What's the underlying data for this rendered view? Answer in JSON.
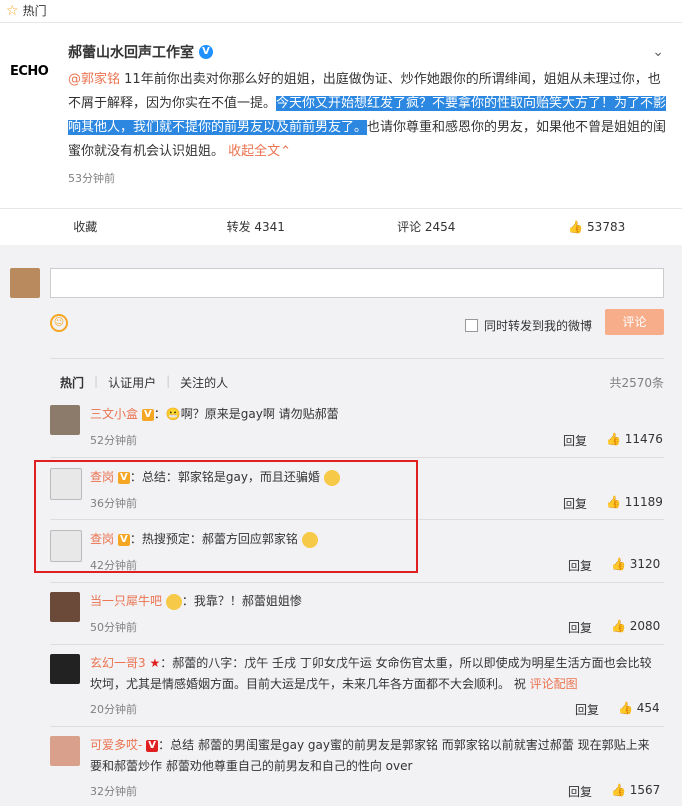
{
  "hot": "热门",
  "post": {
    "avatar_text": "ECHO",
    "author": "郝蕾山水回声工作室",
    "mention": "@郭家铭",
    "text_a": " 11年前你出卖对你那么好的姐姐，出庭做伪证、炒作她跟你的所谓绯闻，姐姐从未理过你，也不屑于解释，因为你实在不值一提。",
    "text_hl": "今天你又开始想红发了疯？不要拿你的性取向贻笑大方了！为了不影响其他人，我们就不提你的前男友以及前前男友了。",
    "text_b": "也请你尊重和感恩你的男友，如果他不曾是姐姐的闺蜜你就没有机会认识姐姐。",
    "collapse": "收起全文",
    "time": "53分钟前"
  },
  "actions": {
    "fav": "收藏",
    "repost": "转发 4341",
    "comment": "评论 2454",
    "like": "53783"
  },
  "compose": {
    "repost_label": "同时转发到我的微博",
    "submit": "评论"
  },
  "filters": {
    "hot": "热门",
    "verified": "认证用户",
    "following": "关注的人",
    "total": "共2570条"
  },
  "comments": [
    {
      "name": "三文小盒",
      "text": "：😬啊？原来是gay啊 请勿贴郝蕾",
      "time": "52分钟前",
      "reply": "回复",
      "likes": "11476"
    },
    {
      "name": "查岗",
      "text": "：总结：郭家铭是gay，而且还骗婚",
      "time": "36分钟前",
      "reply": "回复",
      "likes": "11189"
    },
    {
      "name": "查岗",
      "text": "：热搜预定：郝蕾方回应郭家铭",
      "time": "42分钟前",
      "reply": "回复",
      "likes": "3120"
    },
    {
      "name": "当一只犀牛吧",
      "text": "：我靠？！郝蕾姐姐惨",
      "time": "50分钟前",
      "reply": "回复",
      "likes": "2080"
    },
    {
      "name": "玄幻一哥3",
      "text": "：郝蕾的八字：戊午 壬戌 丁卯女戊午运 女命伤官太重，所以即使成为明星生活方面也会比较坎坷，尤其是情感婚姻方面。目前大运是戊午，未来几年各方面都不大会顺利。 祝",
      "extra": "评论配图",
      "time": "20分钟前",
      "reply": "回复",
      "likes": "454"
    },
    {
      "name": "可爱多哎-",
      "text": "：总结 郝蕾的男闺蜜是gay gay蜜的前男友是郭家铭 而郭家铭以前就害过郝蕾 现在郭贴上来要和郝蕾炒作 郝蕾劝他尊重自己的前男友和自己的性向 over",
      "time": "32分钟前",
      "reply": "回复",
      "likes": "1567"
    }
  ]
}
